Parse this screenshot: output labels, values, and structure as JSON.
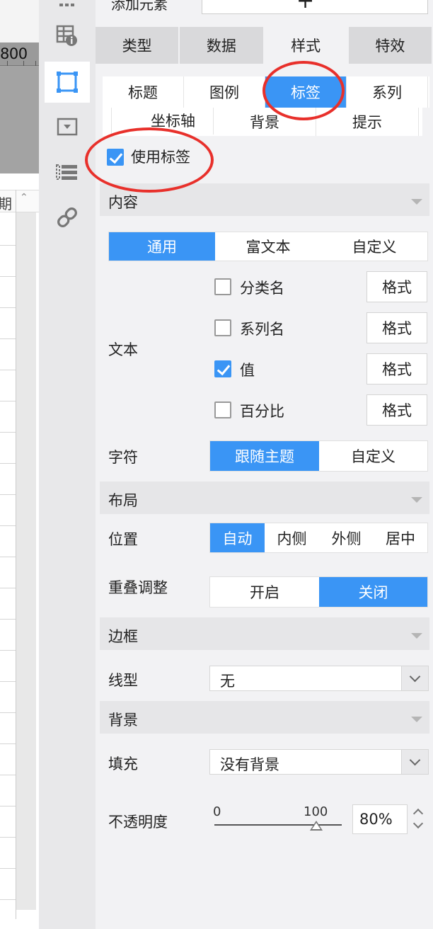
{
  "grid": {
    "header_value": "800"
  },
  "rail": {
    "items": [
      {
        "name": "table-settings-icon",
        "active": false
      },
      {
        "name": "chart-frame-icon",
        "active": true
      },
      {
        "name": "widget-dropdown-icon",
        "active": false
      },
      {
        "name": "layout-list-icon",
        "active": false
      },
      {
        "name": "link-icon",
        "active": false
      }
    ]
  },
  "panel": {
    "add_element_label": "添加元素",
    "main_tabs": [
      {
        "label": "类型",
        "active": false
      },
      {
        "label": "数据",
        "active": false
      },
      {
        "label": "样式",
        "active": true
      },
      {
        "label": "特效",
        "active": false
      }
    ],
    "sub_tabs_row1": [
      {
        "label": "标题",
        "active": false
      },
      {
        "label": "图例",
        "active": false
      },
      {
        "label": "标签",
        "active": true
      },
      {
        "label": "系列",
        "active": false
      }
    ],
    "sub_tabs_row2": [
      {
        "label": "坐标轴"
      },
      {
        "label": "背景"
      },
      {
        "label": "提示"
      }
    ],
    "use_label": {
      "label": "使用标签",
      "checked": true
    },
    "content_section": "内容",
    "content_modes": [
      {
        "label": "通用",
        "active": true
      },
      {
        "label": "富文本",
        "active": false
      },
      {
        "label": "自定义",
        "active": false
      }
    ],
    "text_label": "文本",
    "text_options": [
      {
        "label": "分类名",
        "checked": false,
        "format": "格式"
      },
      {
        "label": "系列名",
        "checked": false,
        "format": "格式"
      },
      {
        "label": "值",
        "checked": true,
        "format": "格式"
      },
      {
        "label": "百分比",
        "checked": false,
        "format": "格式"
      }
    ],
    "char_label": "字符",
    "char_modes": [
      {
        "label": "跟随主题",
        "active": true
      },
      {
        "label": "自定义",
        "active": false
      }
    ],
    "layout_section": "布局",
    "position_label": "位置",
    "position_modes": [
      {
        "label": "自动",
        "active": true
      },
      {
        "label": "内侧",
        "active": false
      },
      {
        "label": "外侧",
        "active": false
      },
      {
        "label": "居中",
        "active": false
      }
    ],
    "overlap_label": "重叠调整",
    "overlap_modes": [
      {
        "label": "开启",
        "active": false
      },
      {
        "label": "关闭",
        "active": true
      }
    ],
    "border_section": "边框",
    "line_type_label": "线型",
    "line_type_value": "无",
    "background_section": "背景",
    "fill_label": "填充",
    "fill_value": "没有背景",
    "opacity_label": "不透明度",
    "opacity_min": "0",
    "opacity_max": "100",
    "opacity_value": "80%",
    "opacity_fraction": 0.8
  },
  "colors": {
    "accent": "#3a95f5",
    "highlight_ring": "#e8302b"
  }
}
